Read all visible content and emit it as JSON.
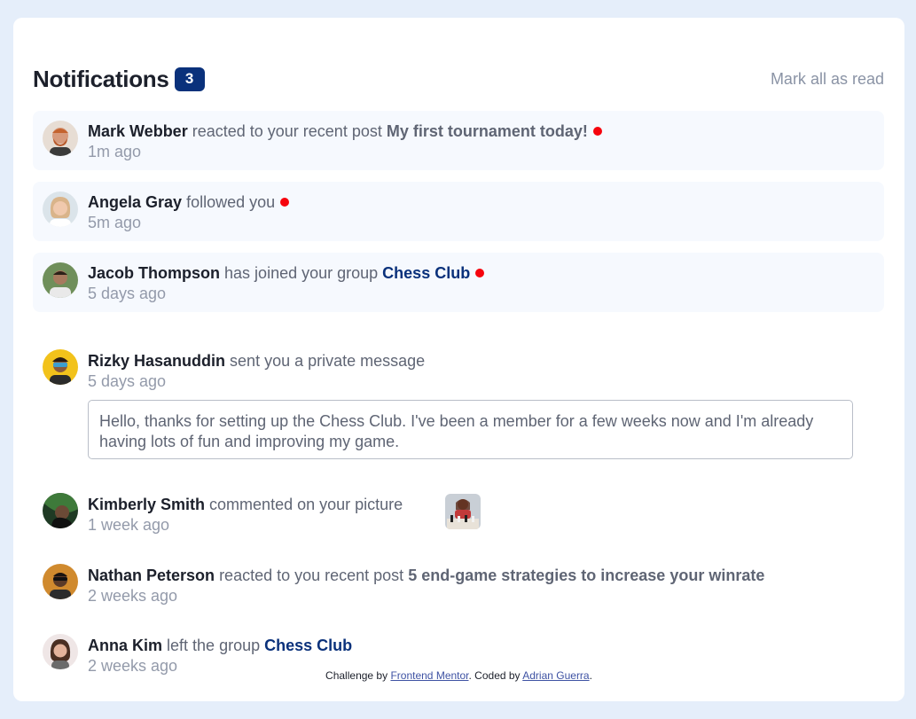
{
  "header": {
    "title": "Notifications",
    "unread_count": "3",
    "mark_all_label": "Mark all as read"
  },
  "notifications": [
    {
      "user": "Mark Webber",
      "action": "reacted to your recent post",
      "target": "My first tournament today!",
      "time": "1m ago",
      "unread": true
    },
    {
      "user": "Angela Gray",
      "action": "followed you",
      "target": "",
      "time": "5m ago",
      "unread": true
    },
    {
      "user": "Jacob Thompson",
      "action": "has joined your group",
      "target": "Chess Club",
      "time": "5 days ago",
      "unread": true
    },
    {
      "user": "Rizky Hasanuddin",
      "action": "sent you a private message",
      "target": "",
      "time": "5 days ago",
      "unread": false,
      "message": "Hello, thanks for setting up the Chess Club. I've been a member for a few weeks now and I'm already having lots of fun and improving my game."
    },
    {
      "user": "Kimberly Smith",
      "action": "commented on your picture",
      "target": "",
      "time": "1 week ago",
      "unread": false
    },
    {
      "user": "Nathan Peterson",
      "action": "reacted to you recent post",
      "target": "5 end-game strategies to increase your winrate",
      "time": "2 weeks ago",
      "unread": false
    },
    {
      "user": "Anna Kim",
      "action": "left the group",
      "target": "Chess Club",
      "time": "2 weeks ago",
      "unread": false
    }
  ],
  "footer": {
    "prefix": "Challenge by",
    "link1": "Frontend Mentor",
    "middle": ". Coded by",
    "link2": "Adrian Guerra",
    "suffix": "."
  },
  "colors": {
    "background": "#e5eefa",
    "accent": "#0a317b",
    "unread_dot": "#f6040d",
    "unread_bg": "#f6f9fe"
  }
}
